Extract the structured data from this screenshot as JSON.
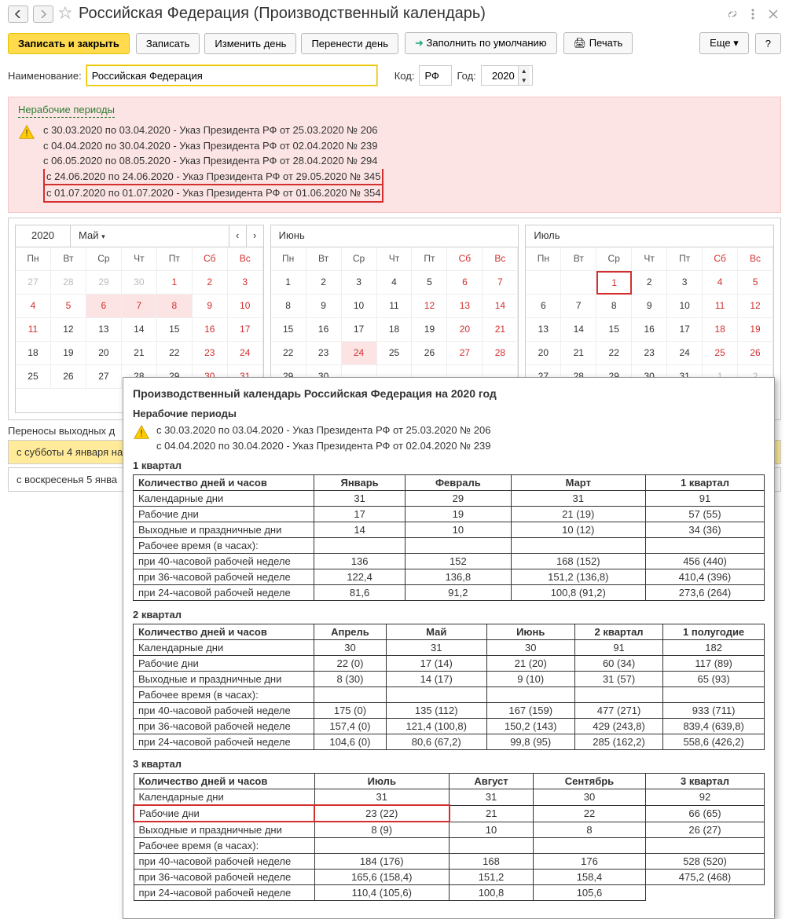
{
  "header": {
    "title": "Российская Федерация (Производственный календарь)"
  },
  "toolbar": {
    "save_close": "Записать и закрыть",
    "save": "Записать",
    "change_day": "Изменить день",
    "move_day": "Перенести день",
    "fill_default": "Заполнить по умолчанию",
    "print": "Печать",
    "more": "Еще",
    "help": "?"
  },
  "form": {
    "name_label": "Наименование:",
    "name_value": "Российская Федерация",
    "code_label": "Код:",
    "code_value": "РФ",
    "year_label": "Год:",
    "year_value": "2020"
  },
  "nonwork": {
    "title": "Нерабочие периоды",
    "items": [
      "с 30.03.2020 по 03.04.2020 - Указ Президента РФ от 25.03.2020 № 206",
      "с 04.04.2020 по 30.04.2020 - Указ Президента РФ от 02.04.2020 № 239",
      "с 06.05.2020 по 08.05.2020 - Указ Президента РФ от 28.04.2020 № 294",
      "с 24.06.2020 по 24.06.2020 - Указ Президента РФ от 29.05.2020 № 345",
      "с 01.07.2020 по 01.07.2020 - Указ Президента РФ от 01.06.2020 № 354"
    ]
  },
  "cal": {
    "year": "2020",
    "dow": [
      "Пн",
      "Вт",
      "Ср",
      "Чт",
      "Пт",
      "Сб",
      "Вс"
    ],
    "months": [
      "Май",
      "Июнь",
      "Июль"
    ]
  },
  "transfers": {
    "label": "Переносы выходных д",
    "r1": "с субботы 4 января на",
    "r2": "с воскресенья 5 янва"
  },
  "popup": {
    "title": "Производственный календарь Российская Федерация на 2020 год",
    "sub": "Нерабочие периоды",
    "decrees": [
      "с 30.03.2020 по 03.04.2020 - Указ Президента РФ от 25.03.2020 № 206",
      "с 04.04.2020 по 30.04.2020 - Указ Президента РФ от 02.04.2020 № 239"
    ],
    "q1": {
      "title": "1 квартал",
      "headers": [
        "Количество дней и часов",
        "Январь",
        "Февраль",
        "Март",
        "1 квартал"
      ],
      "rows": [
        [
          "Календарные дни",
          "31",
          "29",
          "31",
          "91"
        ],
        [
          "Рабочие дни",
          "17",
          "19",
          "21 (19)",
          "57 (55)"
        ],
        [
          "Выходные и праздничные дни",
          "14",
          "10",
          "10 (12)",
          "34 (36)"
        ],
        [
          "Рабочее время (в часах):",
          "",
          "",
          "",
          ""
        ],
        [
          "при 40-часовой рабочей неделе",
          "136",
          "152",
          "168 (152)",
          "456 (440)"
        ],
        [
          "при 36-часовой рабочей неделе",
          "122,4",
          "136,8",
          "151,2 (136,8)",
          "410,4 (396)"
        ],
        [
          "при 24-часовой рабочей неделе",
          "81,6",
          "91,2",
          "100,8 (91,2)",
          "273,6 (264)"
        ]
      ]
    },
    "q2": {
      "title": "2 квартал",
      "headers": [
        "Количество дней и часов",
        "Апрель",
        "Май",
        "Июнь",
        "2 квартал",
        "1 полугодие"
      ],
      "rows": [
        [
          "Календарные дни",
          "30",
          "31",
          "30",
          "91",
          "182"
        ],
        [
          "Рабочие дни",
          "22 (0)",
          "17 (14)",
          "21 (20)",
          "60 (34)",
          "117 (89)"
        ],
        [
          "Выходные и праздничные дни",
          "8 (30)",
          "14 (17)",
          "9 (10)",
          "31 (57)",
          "65 (93)"
        ],
        [
          "Рабочее время (в часах):",
          "",
          "",
          "",
          "",
          ""
        ],
        [
          "при 40-часовой рабочей неделе",
          "175 (0)",
          "135 (112)",
          "167 (159)",
          "477 (271)",
          "933 (711)"
        ],
        [
          "при 36-часовой рабочей неделе",
          "157,4 (0)",
          "121,4 (100,8)",
          "150,2 (143)",
          "429 (243,8)",
          "839,4 (639,8)"
        ],
        [
          "при 24-часовой рабочей неделе",
          "104,6 (0)",
          "80,6 (67,2)",
          "99,8 (95)",
          "285 (162,2)",
          "558,6 (426,2)"
        ]
      ]
    },
    "q3": {
      "title": "3 квартал",
      "headers": [
        "Количество дней и часов",
        "Июль",
        "Август",
        "Сентябрь",
        "3 квартал"
      ],
      "rows": [
        [
          "Календарные дни",
          "31",
          "31",
          "30",
          "92"
        ],
        [
          "Рабочие дни",
          "23 (22)",
          "21",
          "22",
          "66 (65)"
        ],
        [
          "Выходные и праздничные дни",
          "8 (9)",
          "10",
          "8",
          "26 (27)"
        ],
        [
          "Рабочее время (в часах):",
          "",
          "",
          "",
          ""
        ],
        [
          "при 40-часовой рабочей неделе",
          "184 (176)",
          "168",
          "176",
          "528 (520)"
        ],
        [
          "при 36-часовой рабочей неделе",
          "165,6 (158,4)",
          "151,2",
          "158,4",
          "475,2 (468)"
        ],
        [
          "при 24-часовой рабочей неделе",
          "110,4 (105,6)",
          "100,8",
          "105,6"
        ]
      ]
    }
  },
  "chart_data": [
    {
      "type": "table",
      "title": "1 квартал",
      "columns": [
        "Январь",
        "Февраль",
        "Март",
        "1 квартал"
      ],
      "rows": {
        "Календарные дни": [
          31,
          29,
          31,
          91
        ],
        "Рабочие дни": [
          17,
          19,
          "21 (19)",
          "57 (55)"
        ],
        "Выходные и праздничные дни": [
          14,
          10,
          "10 (12)",
          "34 (36)"
        ],
        "при 40-часовой рабочей неделе": [
          136,
          152,
          "168 (152)",
          "456 (440)"
        ],
        "при 36-часовой рабочей неделе": [
          122.4,
          136.8,
          "151,2 (136,8)",
          "410,4 (396)"
        ],
        "при 24-часовой рабочей неделе": [
          81.6,
          91.2,
          "100,8 (91,2)",
          "273,6 (264)"
        ]
      }
    },
    {
      "type": "table",
      "title": "2 квартал",
      "columns": [
        "Апрель",
        "Май",
        "Июнь",
        "2 квартал",
        "1 полугодие"
      ],
      "rows": {
        "Календарные дни": [
          30,
          31,
          30,
          91,
          182
        ],
        "Рабочие дни": [
          "22 (0)",
          "17 (14)",
          "21 (20)",
          "60 (34)",
          "117 (89)"
        ],
        "Выходные и праздничные дни": [
          "8 (30)",
          "14 (17)",
          "9 (10)",
          "31 (57)",
          "65 (93)"
        ],
        "при 40-часовой рабочей неделе": [
          "175 (0)",
          "135 (112)",
          "167 (159)",
          "477 (271)",
          "933 (711)"
        ],
        "при 36-часовой рабочей неделе": [
          "157,4 (0)",
          "121,4 (100,8)",
          "150,2 (143)",
          "429 (243,8)",
          "839,4 (639,8)"
        ],
        "при 24-часовой рабочей неделе": [
          "104,6 (0)",
          "80,6 (67,2)",
          "99,8 (95)",
          "285 (162,2)",
          "558,6 (426,2)"
        ]
      }
    },
    {
      "type": "table",
      "title": "3 квартал",
      "columns": [
        "Июль",
        "Август",
        "Сентябрь",
        "3 квартал"
      ],
      "rows": {
        "Календарные дни": [
          31,
          31,
          30,
          92
        ],
        "Рабочие дни": [
          "23 (22)",
          21,
          22,
          "66 (65)"
        ],
        "Выходные и праздничные дни": [
          "8 (9)",
          10,
          8,
          "26 (27)"
        ],
        "при 40-часовой рабочей неделе": [
          "184 (176)",
          168,
          176,
          "528 (520)"
        ],
        "при 36-часовой рабочей неделе": [
          "165,6 (158,4)",
          151.2,
          158.4,
          "475,2 (468)"
        ],
        "при 24-часовой рабочей неделе": [
          "110,4 (105,6)",
          100.8,
          105.6
        ]
      }
    }
  ]
}
